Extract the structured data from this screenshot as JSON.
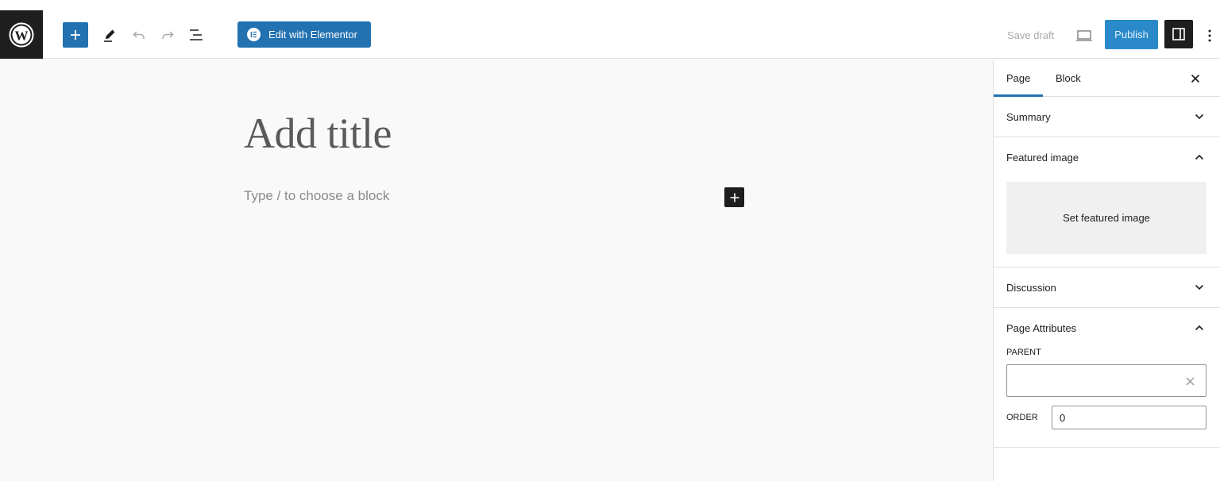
{
  "toolbar": {
    "elementor_label": "Edit with Elementor",
    "save_draft_label": "Save draft",
    "publish_label": "Publish"
  },
  "editor": {
    "title_placeholder": "Add title",
    "block_placeholder": "Type / to choose a block"
  },
  "sidebar": {
    "tabs": [
      {
        "label": "Page",
        "active": true
      },
      {
        "label": "Block",
        "active": false
      }
    ],
    "panels": {
      "summary": {
        "title": "Summary",
        "expanded": false
      },
      "featured_image": {
        "title": "Featured image",
        "expanded": true,
        "button_label": "Set featured image"
      },
      "discussion": {
        "title": "Discussion",
        "expanded": false
      },
      "page_attributes": {
        "title": "Page Attributes",
        "expanded": true,
        "parent_label": "PARENT",
        "parent_value": "",
        "order_label": "ORDER",
        "order_value": "0"
      }
    }
  },
  "colors": {
    "accent": "#2271b1",
    "publish_bg": "#2a8ac9",
    "dark": "#1e1e1e"
  },
  "icons": [
    "wordpress-logo-icon",
    "plus-icon",
    "pen-icon",
    "undo-icon",
    "redo-icon",
    "list-view-icon",
    "elementor-icon",
    "preview-icon",
    "sidebar-toggle-icon",
    "more-vertical-icon",
    "close-icon",
    "chevron-down-icon",
    "chevron-up-icon"
  ]
}
